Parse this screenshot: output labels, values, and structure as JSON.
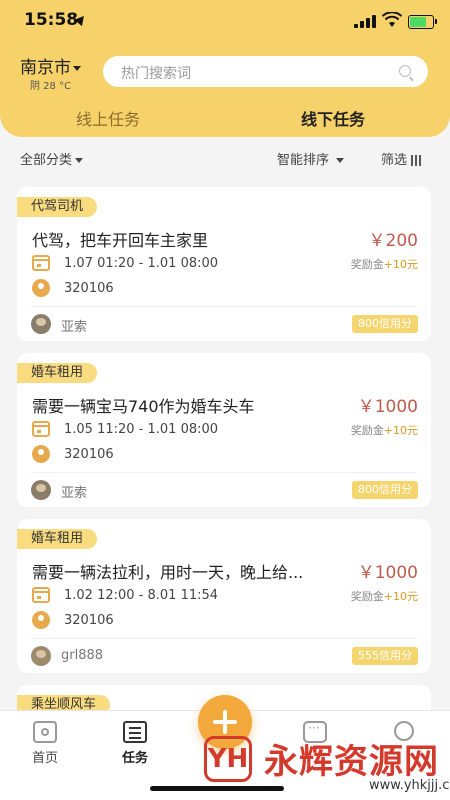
{
  "status_bar": {
    "time": "15:58"
  },
  "header": {
    "city": "南京市",
    "weather": "阴 28 °C",
    "search_placeholder": "热门搜索词",
    "tabs": [
      {
        "label": "线上任务",
        "active": false
      },
      {
        "label": "线下任务",
        "active": true
      }
    ]
  },
  "filters": {
    "category": "全部分类",
    "sort": "智能排序",
    "screen": "筛选"
  },
  "cards": [
    {
      "category": "代驾司机",
      "title": "代驾，把车开回车主家里",
      "price": "￥200",
      "bonus_label": "奖励金",
      "bonus_value": "+10元",
      "datetime": "1.07 01:20 - 1.01 08:00",
      "area": "320106",
      "user": "亚索",
      "credit": "800信用分"
    },
    {
      "category": "婚车租用",
      "title": "需要一辆宝马740作为婚车头车",
      "price": "￥1000",
      "bonus_label": "奖励金",
      "bonus_value": "+10元",
      "datetime": "1.05 11:20 - 1.01 08:00",
      "area": "320106",
      "user": "亚索",
      "credit": "800信用分"
    },
    {
      "category": "婚车租用",
      "title": "需要一辆法拉利，用时一天，晚上给...",
      "price": "￥1000",
      "bonus_label": "奖励金",
      "bonus_value": "+10元",
      "datetime": "1.02 12:00 - 8.01 11:54",
      "area": "320106",
      "user": "grl888",
      "credit": "555信用分"
    }
  ],
  "peek_card": {
    "category": "乘坐顺风车"
  },
  "bottom_nav": {
    "home": "首页",
    "task": "任务",
    "message": "",
    "me": ""
  },
  "watermark": {
    "logo": "YH",
    "text": "永辉资源网",
    "url": "www.yhkjjj.com"
  },
  "colors": {
    "brand_yellow": "#f7d26a",
    "price_red": "#c05a4c",
    "accent_orange": "#f2a83b",
    "credit_badge": "#f5d56d"
  }
}
